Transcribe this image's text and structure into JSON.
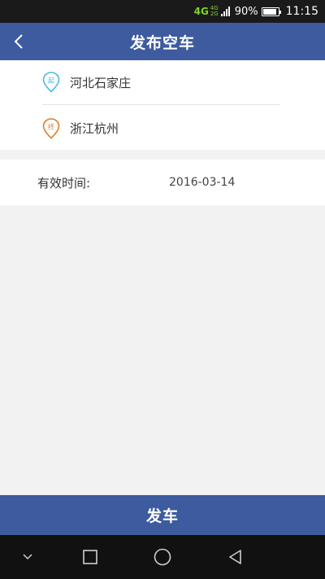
{
  "status_bar": {
    "network": "4G",
    "network_small_top": "4G",
    "network_small_bottom": "2G",
    "battery_percent": "90%",
    "battery_level": 0.9,
    "time": "11:15"
  },
  "header": {
    "title": "发布空车",
    "back_icon": "chevron-left-icon"
  },
  "route": {
    "start": {
      "pin_label": "起",
      "pin_color": "#4ab8e0",
      "city": "河北石家庄"
    },
    "end": {
      "pin_label": "终",
      "pin_color": "#e07b2a",
      "city": "浙江杭州"
    }
  },
  "validity": {
    "label": "有效时间:",
    "value": "2016-03-14"
  },
  "submit": {
    "label": "发车"
  },
  "colors": {
    "accent": "#3d5b9e"
  },
  "nav_bar": {
    "items": [
      "chevron-down-icon",
      "square-icon",
      "circle-icon",
      "triangle-back-icon"
    ]
  }
}
